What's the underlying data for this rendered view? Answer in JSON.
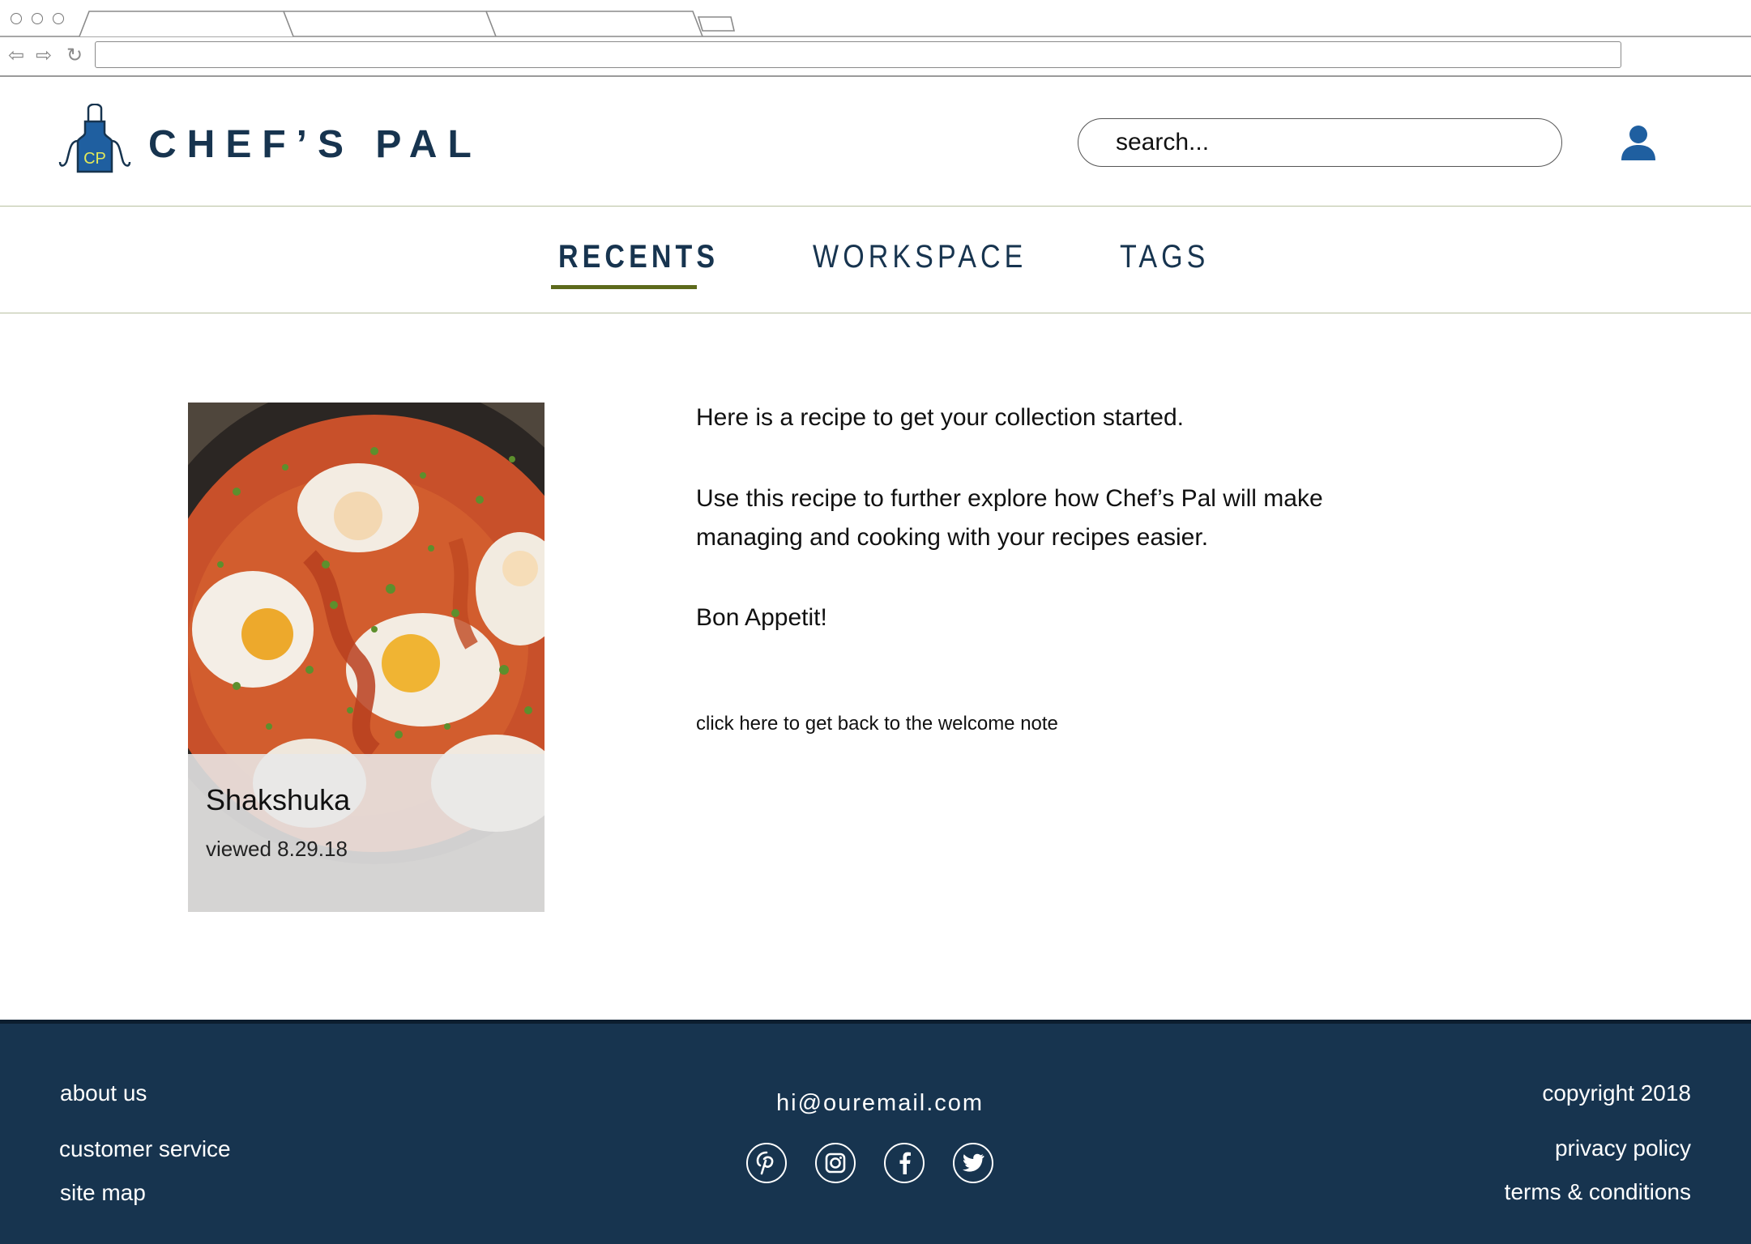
{
  "brand": {
    "name": "CHEF’S PAL",
    "logo_initials": "CP"
  },
  "search": {
    "placeholder": "search..."
  },
  "nav": {
    "tabs": [
      {
        "label": "RECENTS",
        "active": true
      },
      {
        "label": "WORKSPACE",
        "active": false
      },
      {
        "label": "TAGS",
        "active": false
      }
    ]
  },
  "recipe_card": {
    "title": "Shakshuka",
    "viewed": "viewed 8.29.18"
  },
  "intro": {
    "line1": "Here is a recipe to get your collection started.",
    "line2a": "Use this recipe to further explore how Chef’s Pal will make",
    "line2b": "managing and cooking with your recipes easier.",
    "line3": "Bon Appetit!",
    "back_link": "click here to get back to the welcome note"
  },
  "footer": {
    "left_links": [
      "about us",
      "customer service",
      "site map"
    ],
    "email": "hi@ouremail.com",
    "social_icons": [
      "pinterest-icon",
      "instagram-icon",
      "facebook-icon",
      "twitter-icon"
    ],
    "right_links": [
      "copyright 2018",
      "privacy policy",
      "terms & conditions"
    ]
  },
  "colors": {
    "navy": "#17344f",
    "tab_underline": "#5d6a1c",
    "logo_apron": "#1f5fa0",
    "logo_text": "#e3e85a",
    "user_icon": "#1f5fa0"
  }
}
